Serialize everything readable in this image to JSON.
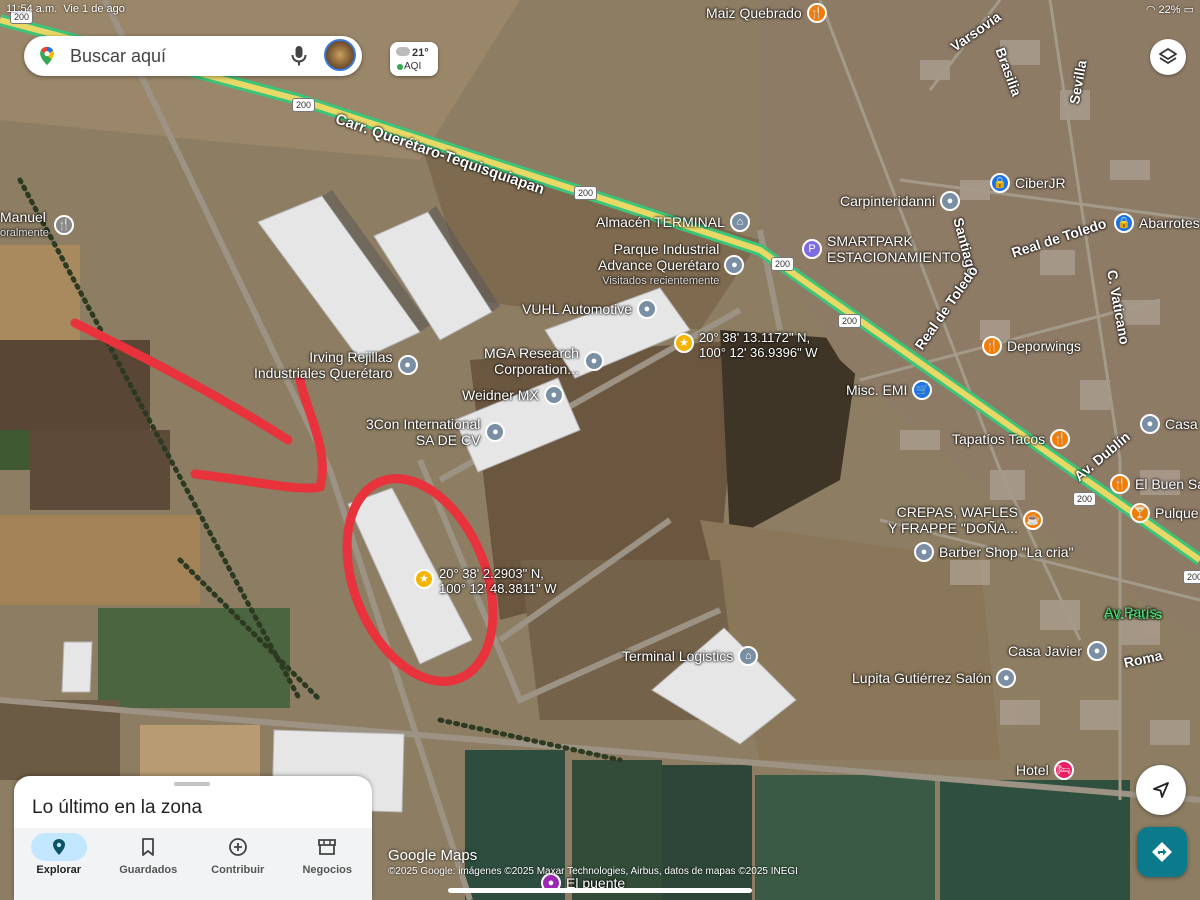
{
  "status_bar": {
    "time": "11:54 a.m.",
    "date": "Vie 1 de ago",
    "battery": "22%"
  },
  "search": {
    "placeholder": "Buscar aquí"
  },
  "weather": {
    "temp": "21°",
    "aqi": "AQI"
  },
  "highway_label": "Carr. Querétaro-Tequisquiapan",
  "route_shields": [
    "200",
    "200",
    "200",
    "200",
    "200",
    "200",
    "200"
  ],
  "streets": [
    "Varsovia",
    "Brasilia",
    "Sevilla",
    "Santiago",
    "Real de Toledo",
    "Real de Toledo",
    "C. Vaticano",
    "Av. Dublín",
    "Av. París",
    "Roma"
  ],
  "pois": [
    {
      "name": "Maiz Quebrado",
      "icon": "restaurant-icon",
      "color": "#f57c00"
    },
    {
      "name": "Manuel",
      "sub": "oralmente",
      "icon": "restaurant-icon",
      "color": "#888888"
    },
    {
      "name": "Almacén TERMINAL",
      "icon": "building-icon",
      "color": "#7a8fa3"
    },
    {
      "name": "Parque Industrial",
      "name2": "Advance Querétaro",
      "sub": "Visitados recientemente",
      "icon": "location-icon",
      "color": "#7a8fa3"
    },
    {
      "name": "Carpinteridanni",
      "icon": "location-icon",
      "color": "#7a8fa3"
    },
    {
      "name": "SMARTPARK",
      "name2": "ESTACIONAMIENTO...",
      "icon": "parking-icon",
      "color": "#7c6ce0"
    },
    {
      "name": "CiberJR",
      "icon": "shopping-icon",
      "color": "#1a73e8"
    },
    {
      "name": "Abarrotes",
      "icon": "shopping-icon",
      "color": "#1a73e8"
    },
    {
      "name": "VUHL Automotive",
      "icon": "location-icon",
      "color": "#7a8fa3"
    },
    {
      "name": "Irving Rejillas",
      "name2": "Industriales Querétaro",
      "icon": "location-icon",
      "color": "#7a8fa3"
    },
    {
      "name": "MGA Research",
      "name2": "Corporation...",
      "icon": "location-icon",
      "color": "#7a8fa3"
    },
    {
      "name": "Weidner MX",
      "icon": "location-icon",
      "color": "#7a8fa3"
    },
    {
      "name": "3Con International",
      "name2": "SA DE CV",
      "icon": "location-icon",
      "color": "#7a8fa3"
    },
    {
      "name": "Deporwings",
      "icon": "restaurant-icon",
      "color": "#f57c00"
    },
    {
      "name": "Misc. EMI",
      "icon": "cart-icon",
      "color": "#1a73e8"
    },
    {
      "name": "Casa",
      "icon": "location-icon",
      "color": "#7a8fa3"
    },
    {
      "name": "Tapatíos Tacos",
      "icon": "restaurant-icon",
      "color": "#f57c00"
    },
    {
      "name": "El Buen Sa",
      "icon": "restaurant-icon",
      "color": "#f57c00"
    },
    {
      "name": "CREPAS, WAFLES",
      "name2": "Y FRAPPE \"DOÑA...",
      "icon": "cafe-icon",
      "color": "#f57c00"
    },
    {
      "name": "Pulque",
      "icon": "bar-icon",
      "color": "#f57c00"
    },
    {
      "name": "Barber Shop \"La cria\"",
      "icon": "location-icon",
      "color": "#7a8fa3"
    },
    {
      "name": "Av París",
      "icon": "none",
      "color": "#34a853"
    },
    {
      "name": "Casa Javier",
      "icon": "location-icon",
      "color": "#7a8fa3"
    },
    {
      "name": "Terminal Logistics",
      "icon": "building-icon",
      "color": "#7a8fa3"
    },
    {
      "name": "Lupita Gutiérrez Salón",
      "icon": "location-icon",
      "color": "#7a8fa3"
    },
    {
      "name": "Hotel",
      "icon": "hotel-icon",
      "color": "#e91e63"
    },
    {
      "name": "El puente",
      "icon": "location-icon",
      "color": "#9c27b0"
    }
  ],
  "coordinates": [
    {
      "lat": "20° 38' 13.1172\" N,",
      "lng": "100° 12' 36.9396\" W"
    },
    {
      "lat": "20° 38' 2.2903\" N,",
      "lng": "100° 12' 48.3811\" W"
    }
  ],
  "bottom_sheet": {
    "title": "Lo último en la zona"
  },
  "nav": [
    {
      "label": "Explorar",
      "icon": "pin-icon",
      "active": true
    },
    {
      "label": "Guardados",
      "icon": "bookmark-icon",
      "active": false
    },
    {
      "label": "Contribuir",
      "icon": "plus-circle-icon",
      "active": false
    },
    {
      "label": "Negocios",
      "icon": "store-icon",
      "active": false
    }
  ],
  "branding": "Google Maps",
  "attribution": "©2025 Google: imágenes ©2025 Maxar Technologies, Airbus, datos de mapas ©2025 INEGI",
  "colors": {
    "highway": "#e8d866",
    "highway_edge": "#3cc47a",
    "annotation": "#e8323c",
    "accent": "#1a73e8",
    "directions_button": "#0b7b8b"
  }
}
